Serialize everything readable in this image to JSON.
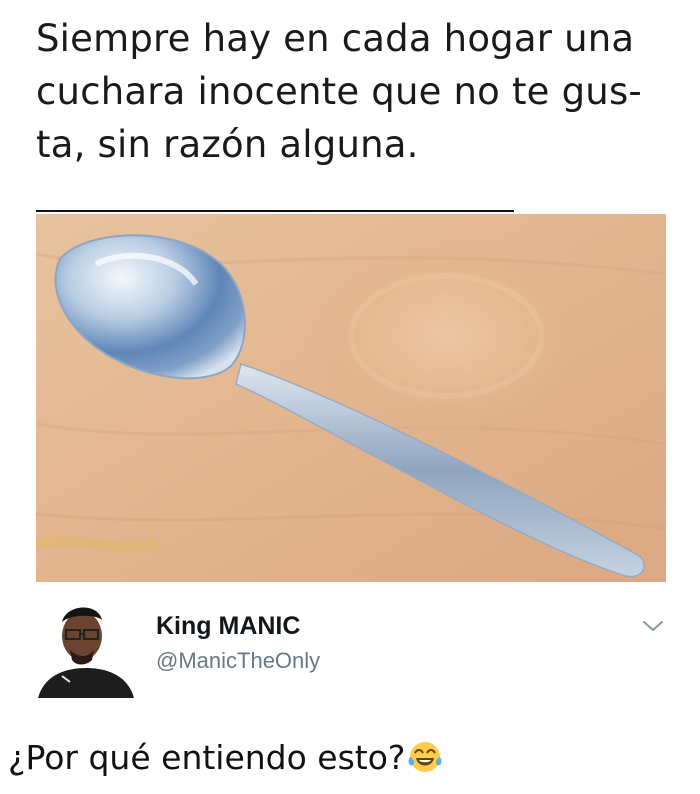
{
  "meme": {
    "headline_lines": [
      "Siempre hay en cada hogar una",
      "cuchara inocente que no te gus-",
      "ta, sin razón alguna."
    ],
    "image_icon": "spoon-on-wood-photo"
  },
  "tweet": {
    "display_name": "King MANIC",
    "handle": "@ManicTheOnly",
    "avatar_icon": "profile-photo",
    "menu_icon": "chevron-down-icon",
    "text": "¿Por qué entiendo esto?",
    "emoji_icon": "face-with-tears-of-joy-icon"
  },
  "colors": {
    "name": "#14171a",
    "handle": "#6a7883",
    "wood": "#e3b892",
    "spoon": "#aab7c8"
  }
}
